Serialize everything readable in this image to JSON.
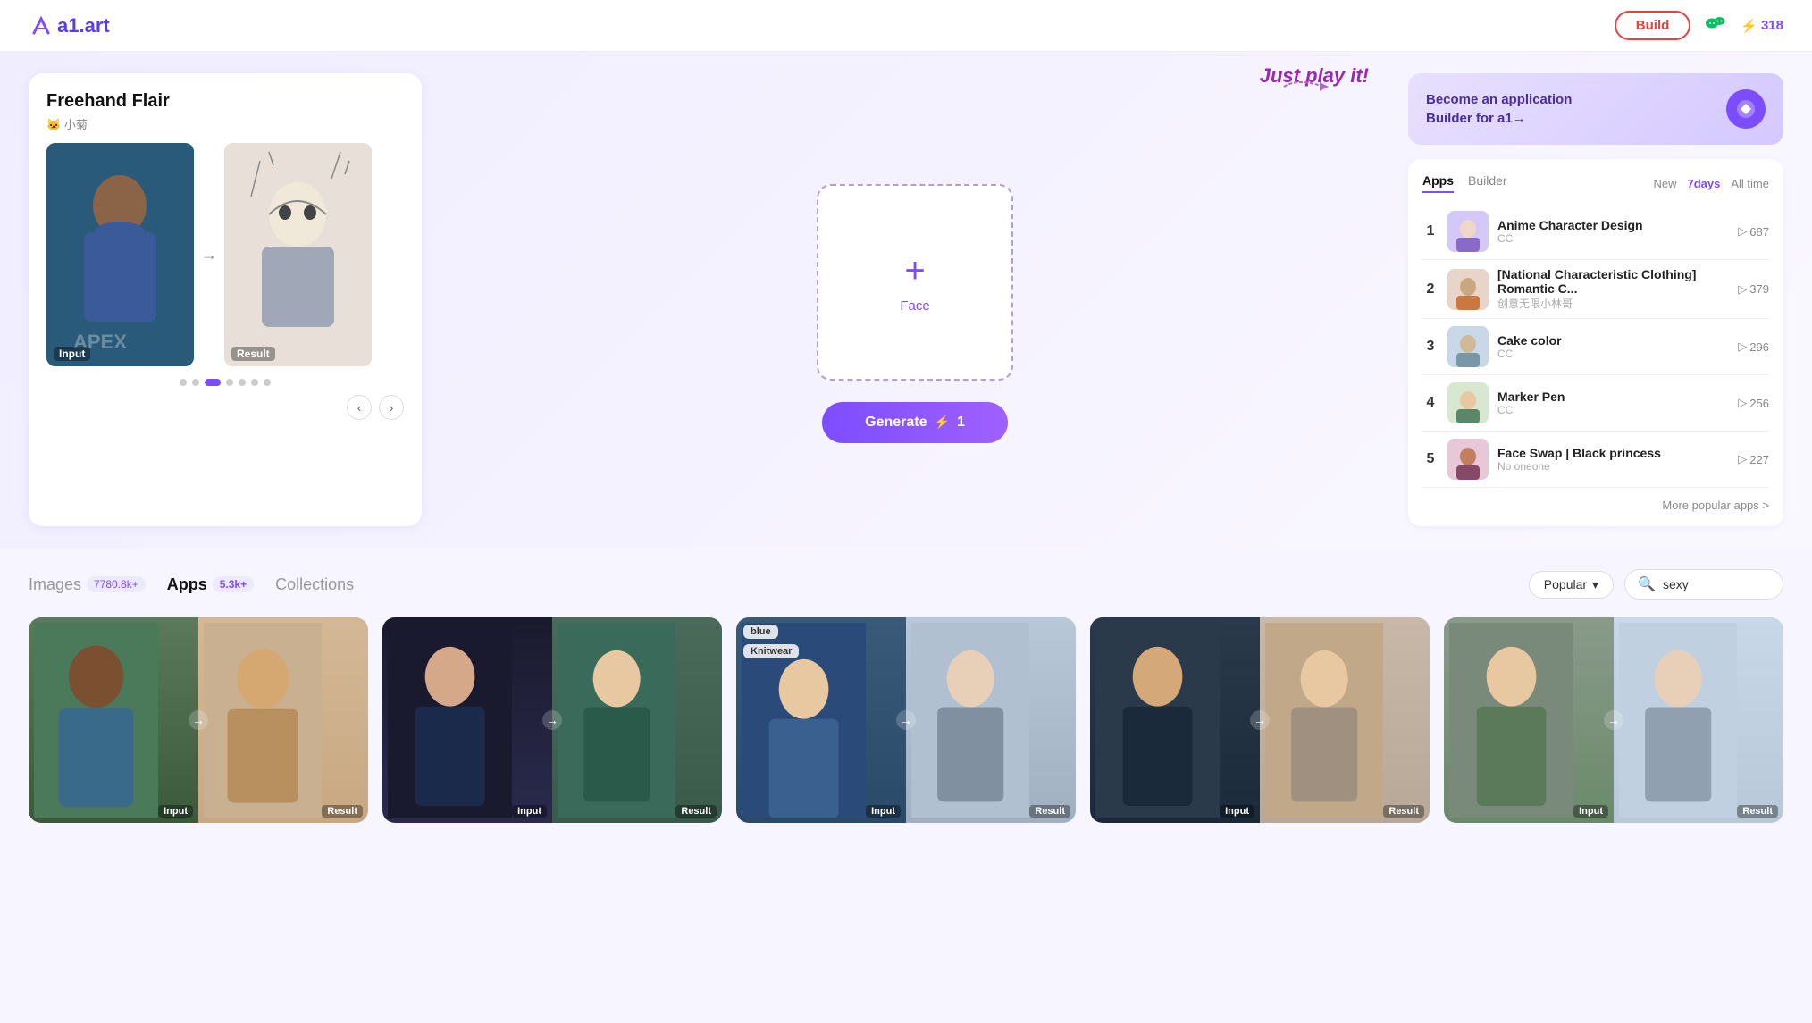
{
  "header": {
    "logo": "a1.art",
    "build_label": "Build",
    "credits": "318"
  },
  "hero": {
    "freehand": {
      "title": "Freehand Flair",
      "author": "小菊",
      "author_icon": "🐱",
      "input_label": "Input",
      "result_label": "Result",
      "dots": 7,
      "active_dot": 3
    },
    "just_play": "Just play it!",
    "upload_face_label": "Face",
    "generate_label": "Generate",
    "generate_cost": "1",
    "become_builder_line1": "Become an application",
    "become_builder_line2": "Builder for a1→",
    "panel": {
      "tabs": [
        "Apps",
        "Builder"
      ],
      "active_tab": "Apps",
      "time_tabs": [
        "New",
        "7days",
        "All time"
      ],
      "active_time": "7days",
      "items": [
        {
          "rank": 1,
          "name": "Anime Character Design",
          "sub": "CC",
          "count": "687",
          "color": "#d4c8f8"
        },
        {
          "rank": 2,
          "name": "[National Characteristic Clothing] Romantic C...",
          "sub": "创意无限小林哥",
          "count": "379",
          "color": "#e8d4c8"
        },
        {
          "rank": 3,
          "name": "Cake color",
          "sub": "CC",
          "count": "296",
          "color": "#c8d8e8"
        },
        {
          "rank": 4,
          "name": "Marker Pen",
          "sub": "CC",
          "count": "256",
          "color": "#d8e8d0"
        },
        {
          "rank": 5,
          "name": "Face Swap | Black princess",
          "sub": "No oneone",
          "count": "227",
          "color": "#e8c8d8"
        }
      ],
      "more_label": "More popular apps >"
    }
  },
  "bottom": {
    "tabs": [
      {
        "label": "Images",
        "badge": "7780.8k+",
        "active": false
      },
      {
        "label": "Apps",
        "badge": "5.3k+",
        "active": true
      },
      {
        "label": "Collections",
        "badge": "",
        "active": false
      }
    ],
    "filter": {
      "sort_label": "Popular",
      "search_placeholder": "sexy",
      "search_value": "sexy"
    },
    "cards": [
      {
        "input_label": "Input",
        "result_label": "Result",
        "bg_left": "card-bg-1a",
        "bg_right": "card-bg-1b"
      },
      {
        "input_label": "Input",
        "result_label": "Result",
        "bg_left": "card-bg-2a",
        "bg_right": "card-bg-2b"
      },
      {
        "input_label": "Input",
        "result_label": "Result",
        "bg_left": "card-bg-3a",
        "bg_right": "card-bg-3b",
        "tag1": "blue",
        "tag2": "Knitwear"
      },
      {
        "input_label": "Input",
        "result_label": "Result",
        "bg_left": "card-bg-4a",
        "bg_right": "card-bg-4b"
      },
      {
        "input_label": "Input",
        "result_label": "Result",
        "bg_left": "card-bg-5a",
        "bg_right": "card-bg-5b"
      }
    ]
  }
}
